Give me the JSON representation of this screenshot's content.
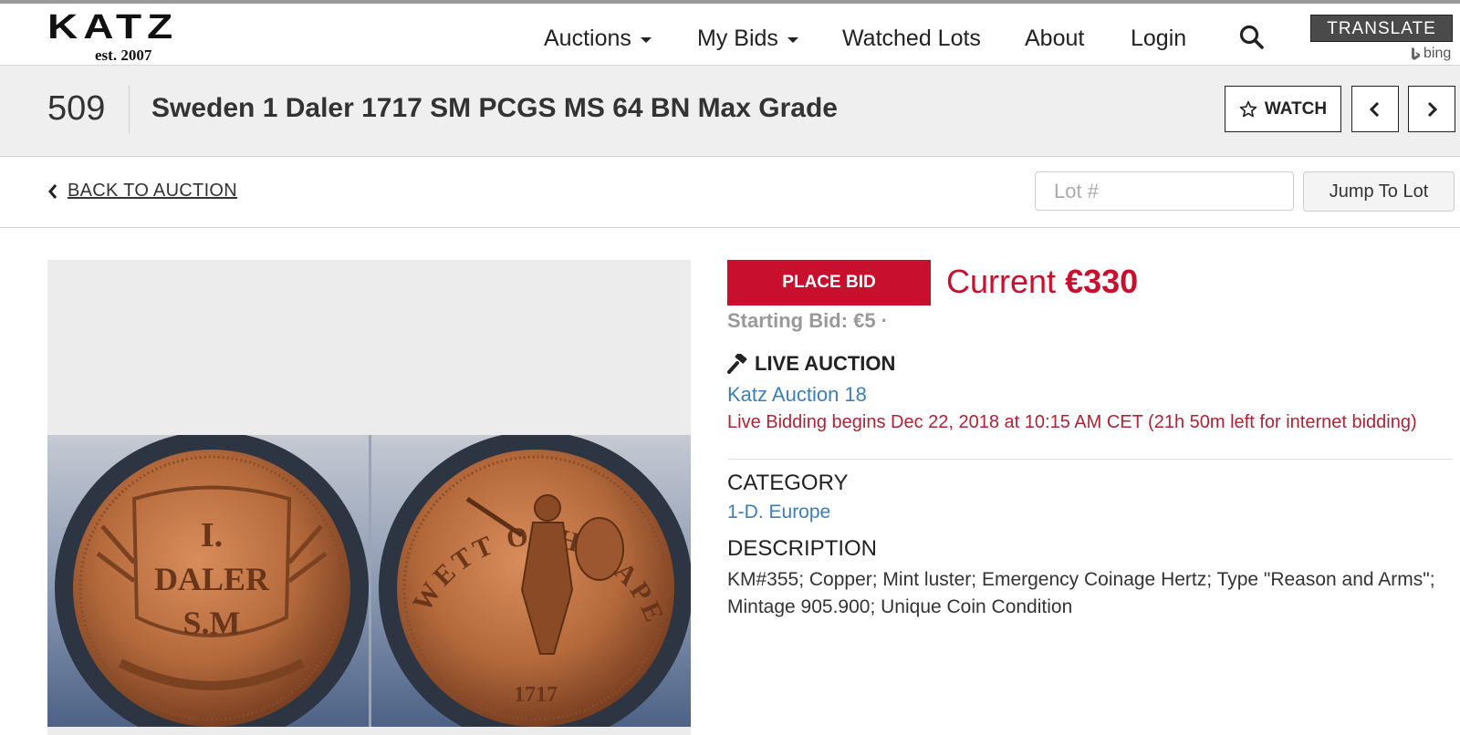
{
  "header": {
    "logo_text": "KATZ",
    "logo_tagline": "est. 2007",
    "nav": {
      "auctions": "Auctions",
      "my_bids": "My Bids",
      "watched_lots": "Watched Lots",
      "about": "About",
      "login": "Login"
    },
    "search_icon": "search-icon",
    "translate_label": "TRANSLATE",
    "bing_label": "bing"
  },
  "lot": {
    "number": "509",
    "title": "Sweden 1 Daler 1717 SM PCGS MS 64 BN Max Grade",
    "watch_label": "WATCH"
  },
  "navigation": {
    "back_label": "BACK TO AUCTION",
    "lot_placeholder": "Lot #",
    "jump_label": "Jump To Lot"
  },
  "bidding": {
    "place_bid_label": "PLACE BID",
    "current_label": "Current",
    "current_value": "€330",
    "starting_bid": "Starting Bid: €5 ·",
    "live_auction_label": "LIVE AUCTION",
    "auction_name": "Katz Auction 18",
    "live_note": "Live Bidding begins Dec 22, 2018 at 10:15 AM CET (21h 50m left for internet bidding)"
  },
  "details": {
    "category_heading": "CATEGORY",
    "category_value": "1-D. Europe",
    "description_heading": "DESCRIPTION",
    "description_text": "KM#355; Copper; Mint luster; Emergency Coinage Hertz; Type \"Reason and Arms\"; Mintage 905.900; Unique Coin Condition"
  },
  "coin_image": {
    "obverse_lines": [
      "I.",
      "DALER",
      "S.M"
    ],
    "reverse_legend": "WETT OCH WAPEN",
    "reverse_date": "1717"
  },
  "colors": {
    "accent_red": "#c8102e",
    "link_blue": "#3a7fb8",
    "title_bar_bg": "#efefef"
  }
}
